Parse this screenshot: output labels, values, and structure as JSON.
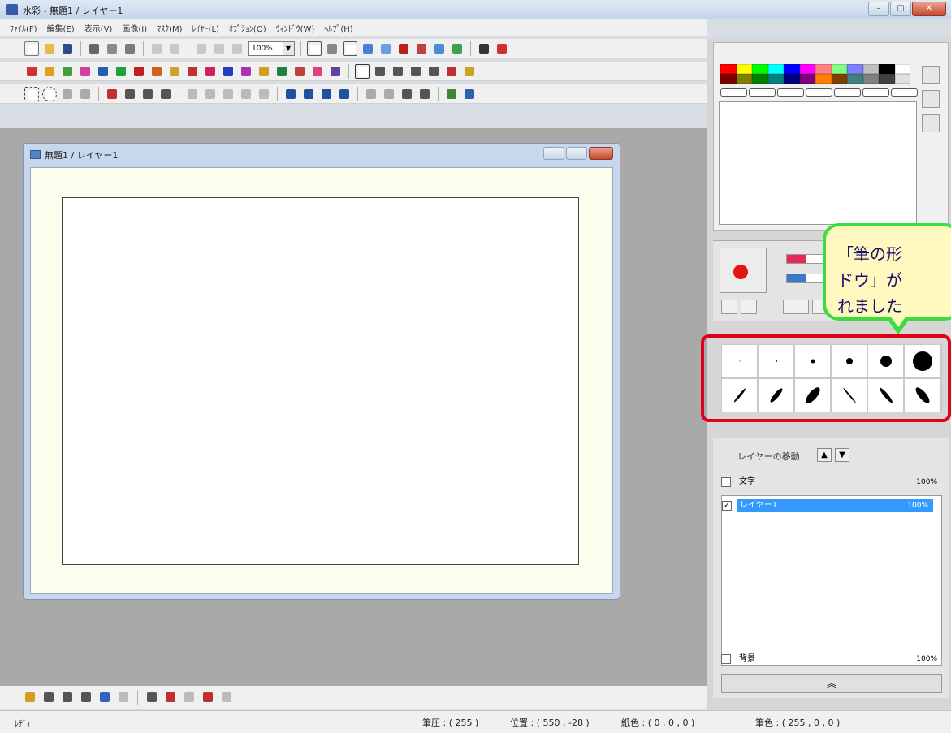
{
  "window": {
    "title": "水彩 - 無題1 / レイヤー1"
  },
  "menu": [
    "ﾌｧｲﾙ(F)",
    "編集(E)",
    "表示(V)",
    "画像(I)",
    "ﾏｽｸ(M)",
    "ﾚｲﾔｰ(L)",
    "ｵﾌﾟｼｮﾝ(O)",
    "ｳｨﾝﾄﾞｳ(W)",
    "ﾍﾙﾌﾟ(H)"
  ],
  "toolbar": {
    "zoom": "100%"
  },
  "document": {
    "title": "無題1 / レイヤー1"
  },
  "status": {
    "ready": "ﾚﾃﾞｨ",
    "pressure": "筆圧 : ( 255 )",
    "position": "位置 : ( 550 , -28 )",
    "paper_color": "紙色 : ( 0 , 0 , 0 )",
    "brush_color": "筆色 : ( 255 , 0 , 0 )"
  },
  "palette": {
    "colors": [
      "#ff0000",
      "#ffff00",
      "#00ff00",
      "#00ffff",
      "#0000ff",
      "#ff00ff",
      "#ff8080",
      "#80ff80",
      "#8080ff",
      "#c0c0c0",
      "#000000",
      "#ffffff",
      "#800000",
      "#808000",
      "#008000",
      "#008080",
      "#000080",
      "#800080",
      "#ff8000",
      "#804000",
      "#408080",
      "#808080",
      "#404040",
      "#e0e0e0"
    ]
  },
  "layers": {
    "move_label": "レイヤーの移動",
    "items": [
      {
        "name": "文字",
        "opacity": "100%",
        "checked": false
      },
      {
        "name": "レイヤー1",
        "opacity": "100%",
        "checked": true
      },
      {
        "name": "背景",
        "opacity": "100%",
        "checked": false
      }
    ],
    "collapse": "︽"
  },
  "callout": {
    "text": "「筆の形\nドウ」が\nれました"
  },
  "colors": {
    "accent_red": "#e0001a",
    "callout_border": "#3cdc3c",
    "callout_fill": "#fff9c0",
    "selected_layer": "#3399ff"
  }
}
